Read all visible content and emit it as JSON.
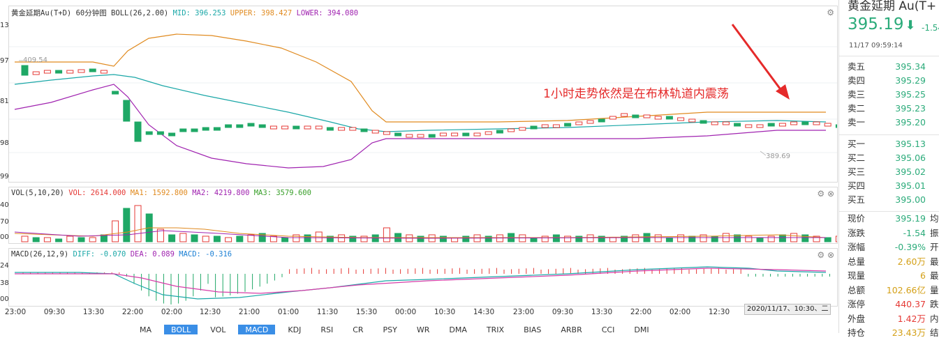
{
  "main_chart": {
    "title": "黄金延期Au(T+D) 60分钟图",
    "indicator": "BOLL(26,2.00)",
    "mid": "MID: 396.253",
    "upper": "UPPER: 398.427",
    "lower": "LOWER: 394.080",
    "y_labels": [
      "13",
      "97",
      "81",
      "98",
      "99"
    ],
    "high_label": "409.54",
    "low_label": "389.69",
    "annotation": "1小时走势依然是在布林轨道内震荡",
    "colors": {
      "mid": "#1aa7a7",
      "upper": "#e08a1f",
      "lower": "#a023b0",
      "up": "#e53935",
      "down": "#1fa866"
    }
  },
  "vol_chart": {
    "label": "VOL(5,10,20)",
    "vol": "VOL: 2614.000",
    "ma1": "MA1: 1592.800",
    "ma2": "MA2: 4219.800",
    "ma3": "MA3: 3579.600",
    "y_labels": [
      "40",
      "70",
      "00"
    ]
  },
  "macd_chart": {
    "label": "MACD(26,12,9)",
    "diff": "DIFF: -0.070",
    "dea": "DEA: 0.089",
    "macd": "MACD: -0.316",
    "y_labels": [
      "24",
      "38",
      "00"
    ]
  },
  "x_axis": [
    "23:00",
    "09:30",
    "13:30",
    "22:00",
    "02:00",
    "12:30",
    "21:00",
    "01:00",
    "11:30",
    "15:30",
    "00:00",
    "10:30",
    "14:30",
    "23:00",
    "09:30",
    "13:30",
    "22:00",
    "02:00",
    "12:30"
  ],
  "cursor_date": "2020/11/17、10:30、二",
  "tabs": [
    {
      "label": "MA",
      "active": false
    },
    {
      "label": "BOLL",
      "active": true
    },
    {
      "label": "VOL",
      "active": false
    },
    {
      "label": "MACD",
      "active": true
    },
    {
      "label": "KDJ",
      "active": false
    },
    {
      "label": "RSI",
      "active": false
    },
    {
      "label": "CR",
      "active": false
    },
    {
      "label": "PSY",
      "active": false
    },
    {
      "label": "WR",
      "active": false
    },
    {
      "label": "DMA",
      "active": false
    },
    {
      "label": "TRIX",
      "active": false
    },
    {
      "label": "BIAS",
      "active": false
    },
    {
      "label": "ARBR",
      "active": false
    },
    {
      "label": "CCI",
      "active": false
    },
    {
      "label": "DMI",
      "active": false
    }
  ],
  "quote": {
    "name": "黄金延期 Au(T+",
    "price": "395.19",
    "change": "-1.54",
    "timestamp": "11/17  09:59:14",
    "asks": [
      {
        "label": "卖五",
        "price": "395.34"
      },
      {
        "label": "卖四",
        "price": "395.29"
      },
      {
        "label": "卖三",
        "price": "395.25"
      },
      {
        "label": "卖二",
        "price": "395.23"
      },
      {
        "label": "卖一",
        "price": "395.20"
      }
    ],
    "bids": [
      {
        "label": "买一",
        "price": "395.13"
      },
      {
        "label": "买二",
        "price": "395.06"
      },
      {
        "label": "买三",
        "price": "395.02"
      },
      {
        "label": "买四",
        "price": "395.01"
      },
      {
        "label": "买五",
        "price": "395.00"
      }
    ],
    "stats": [
      {
        "label": "现价",
        "value": "395.19",
        "extra": "均",
        "color": "#2bab7a"
      },
      {
        "label": "涨跌",
        "value": "-1.54",
        "extra": "振",
        "color": "#2bab7a"
      },
      {
        "label": "涨幅",
        "value": "-0.39%",
        "extra": "开",
        "color": "#2bab7a"
      },
      {
        "label": "总量",
        "value": "2.60万",
        "extra": "最",
        "color": "#d4a017"
      },
      {
        "label": "现量",
        "value": "6",
        "extra": "最",
        "color": "#d4a017"
      },
      {
        "label": "总额",
        "value": "102.66亿",
        "extra": "量",
        "color": "#d4a017"
      },
      {
        "label": "涨停",
        "value": "440.37",
        "extra": "跌",
        "color": "#e53935"
      },
      {
        "label": "外盘",
        "value": "1.42万",
        "extra": "内",
        "color": "#e53935"
      },
      {
        "label": "持仓",
        "value": "23.43万",
        "extra": "结",
        "color": "#d4a017"
      }
    ]
  }
}
